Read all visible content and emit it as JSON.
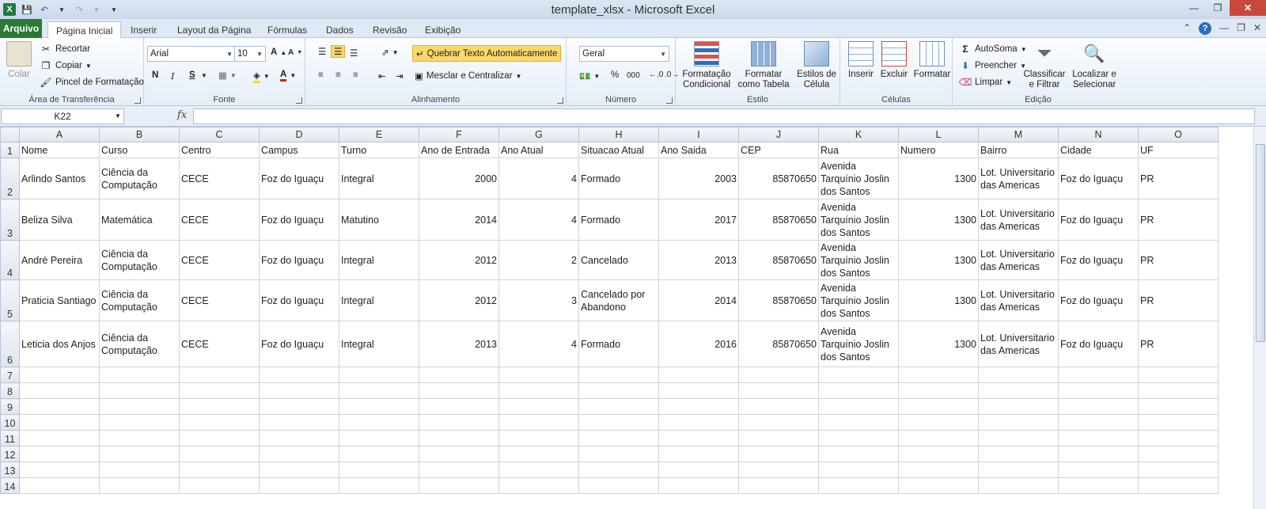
{
  "window": {
    "title": "template_xlsx  -  Microsoft Excel"
  },
  "tabs": [
    "Arquivo",
    "Página Inicial",
    "Inserir",
    "Layout da Página",
    "Fórmulas",
    "Dados",
    "Revisão",
    "Exibição"
  ],
  "ribbon": {
    "clipboard": {
      "paste": "Colar",
      "cut": "Recortar",
      "copy": "Copiar",
      "format_painter": "Pincel de Formatação",
      "label": "Área de Transferência"
    },
    "font": {
      "name": "Arial",
      "size": "10",
      "bold": "N",
      "italic": "I",
      "underline": "S",
      "label": "Fonte"
    },
    "alignment": {
      "wrap": "Quebrar Texto Automaticamente",
      "merge": "Mesclar e Centralizar",
      "label": "Alinhamento"
    },
    "number": {
      "format": "Geral",
      "percent": "%",
      "thousands": "000",
      "label": "Número"
    },
    "styles": {
      "conditional": "Formatação Condicional",
      "table": "Formatar como Tabela",
      "cell_styles": "Estilos de Célula",
      "label": "Estilo"
    },
    "cells": {
      "insert": "Inserir",
      "delete": "Excluir",
      "format": "Formatar",
      "label": "Células"
    },
    "editing": {
      "autosum": "AutoSoma",
      "fill": "Preencher",
      "clear": "Limpar",
      "sort": "Classificar e Filtrar",
      "find": "Localizar e Selecionar",
      "label": "Edição"
    }
  },
  "formula_bar": {
    "name_box": "K22",
    "fx": "fx",
    "value": ""
  },
  "sheet": {
    "columns": [
      "A",
      "B",
      "C",
      "D",
      "E",
      "F",
      "G",
      "H",
      "I",
      "J",
      "K",
      "L",
      "M",
      "N",
      "O"
    ],
    "selected_column": "K",
    "rows": [
      {
        "n": "1",
        "cells": [
          "Nome",
          "Curso",
          "Centro",
          "Campus",
          "Turno",
          "Ano de Entrada",
          "Ano Atual",
          "Situacao Atual",
          "Ano Saida",
          "CEP",
          "Rua",
          "Numero",
          "Bairro",
          "Cidade",
          "UF"
        ]
      },
      {
        "n": "2",
        "cells": [
          "Arlindo Santos",
          "Ciência da Computação",
          "CECE",
          "Foz do Iguaçu",
          "Integral",
          "2000",
          "4",
          "Formado",
          "2003",
          "85870650",
          "Avenida Tarquínio Joslin dos Santos",
          "1300",
          "Lot. Universitario das Americas",
          "Foz do Iguaçu",
          "PR"
        ]
      },
      {
        "n": "3",
        "cells": [
          "Beliza Silva",
          "Matemática",
          "CECE",
          "Foz do Iguaçu",
          "Matutino",
          "2014",
          "4",
          "Formado",
          "2017",
          "85870650",
          "Avenida Tarquínio Joslin dos Santos",
          "1300",
          "Lot. Universitario das Americas",
          "Foz do Iguaçu",
          "PR"
        ]
      },
      {
        "n": "4",
        "cells": [
          "André Pereira",
          "Ciência da Computação",
          "CECE",
          "Foz do Iguaçu",
          "Integral",
          "2012",
          "2",
          "Cancelado",
          "2013",
          "85870650",
          "Avenida Tarquínio Joslin dos Santos",
          "1300",
          "Lot. Universitario das Americas",
          "Foz do Iguaçu",
          "PR"
        ]
      },
      {
        "n": "5",
        "cells": [
          "Praticia Santiago",
          "Ciência da Computação",
          "CECE",
          "Foz do Iguaçu",
          "Integral",
          "2012",
          "3",
          "Cancelado por Abandono",
          "2014",
          "85870650",
          "Avenida Tarquínio Joslin dos Santos",
          "1300",
          "Lot. Universitario das Americas",
          "Foz do Iguaçu",
          "PR"
        ]
      },
      {
        "n": "6",
        "cells": [
          "Leticia dos Anjos",
          "Ciência da Computação",
          "CECE",
          "Foz do Iguaçu",
          "Integral",
          "2013",
          "4",
          "Formado",
          "2016",
          "85870650",
          "Avenida Tarquínio Joslin dos Santos",
          "1300",
          "Lot. Universitario das Americas",
          "Foz do Iguaçu",
          "PR"
        ]
      },
      {
        "n": "7",
        "cells": []
      },
      {
        "n": "8",
        "cells": []
      },
      {
        "n": "9",
        "cells": []
      },
      {
        "n": "10",
        "cells": []
      },
      {
        "n": "11",
        "cells": []
      },
      {
        "n": "12",
        "cells": []
      },
      {
        "n": "13",
        "cells": []
      },
      {
        "n": "14",
        "cells": []
      }
    ]
  }
}
